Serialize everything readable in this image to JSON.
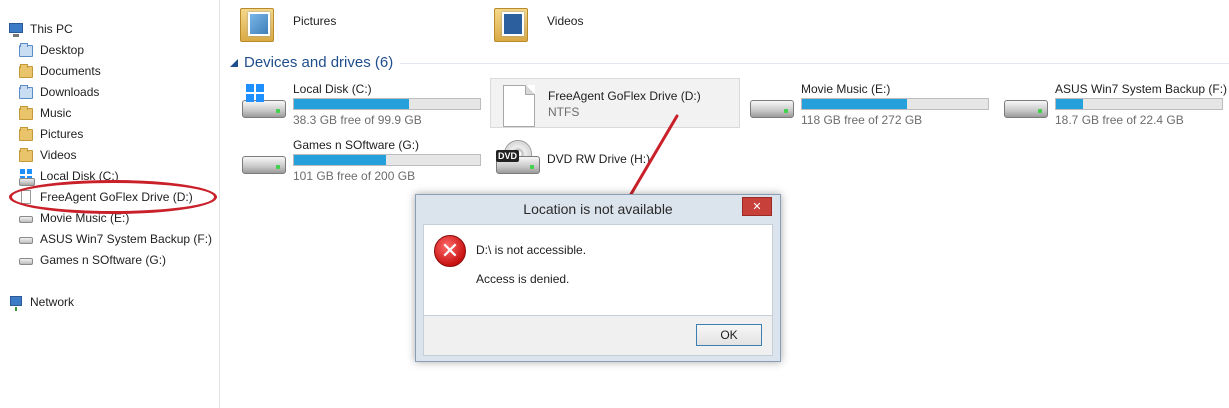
{
  "nav": {
    "this_pc": "This PC",
    "items": [
      {
        "label": "Desktop",
        "icon": "desktop-folder-icon"
      },
      {
        "label": "Documents",
        "icon": "documents-folder-icon"
      },
      {
        "label": "Downloads",
        "icon": "downloads-folder-icon"
      },
      {
        "label": "Music",
        "icon": "music-folder-icon"
      },
      {
        "label": "Pictures",
        "icon": "pictures-folder-icon"
      },
      {
        "label": "Videos",
        "icon": "videos-folder-icon"
      },
      {
        "label": "Local Disk (C:)",
        "icon": "windows-drive-icon"
      },
      {
        "label": "FreeAgent GoFlex Drive (D:)",
        "icon": "blank-drive-icon"
      },
      {
        "label": "Movie Music (E:)",
        "icon": "drive-icon"
      },
      {
        "label": "ASUS Win7 System Backup (F:)",
        "icon": "drive-icon"
      },
      {
        "label": "Games n SOftware (G:)",
        "icon": "drive-icon"
      }
    ],
    "network": "Network"
  },
  "folders": [
    {
      "label": "Pictures"
    },
    {
      "label": "Videos"
    }
  ],
  "group": {
    "title": "Devices and drives (6)"
  },
  "drives": [
    {
      "name": "Local Disk (C:)",
      "sub": "38.3 GB free of 99.9 GB",
      "used_fraction": 0.617,
      "icon": "windows-hdd-icon"
    },
    {
      "name": "FreeAgent GoFlex Drive (D:)",
      "sub": "NTFS",
      "icon": "blank-page-icon"
    },
    {
      "name": "Movie Music (E:)",
      "sub": "118 GB free of 272 GB",
      "used_fraction": 0.566,
      "icon": "hdd-icon"
    },
    {
      "name": "ASUS Win7 System Backup (F:)",
      "sub": "18.7 GB free of 22.4 GB",
      "used_fraction": 0.165,
      "icon": "hdd-icon"
    },
    {
      "name": "Games n SOftware (G:)",
      "sub": "101 GB free of 200 GB",
      "used_fraction": 0.495,
      "icon": "hdd-icon"
    },
    {
      "name": "DVD RW Drive (H:)",
      "icon": "dvd-drive-icon",
      "badge": "DVD"
    }
  ],
  "dialog": {
    "title": "Location is not available",
    "close": "✕",
    "error_glyph": "✕",
    "message_1": "D:\\ is not accessible.",
    "message_2": "Access is denied.",
    "ok": "OK"
  },
  "colors": {
    "accent": "#26a0da",
    "annotation_red": "#c9202a",
    "group_header": "#1f4e8c"
  }
}
